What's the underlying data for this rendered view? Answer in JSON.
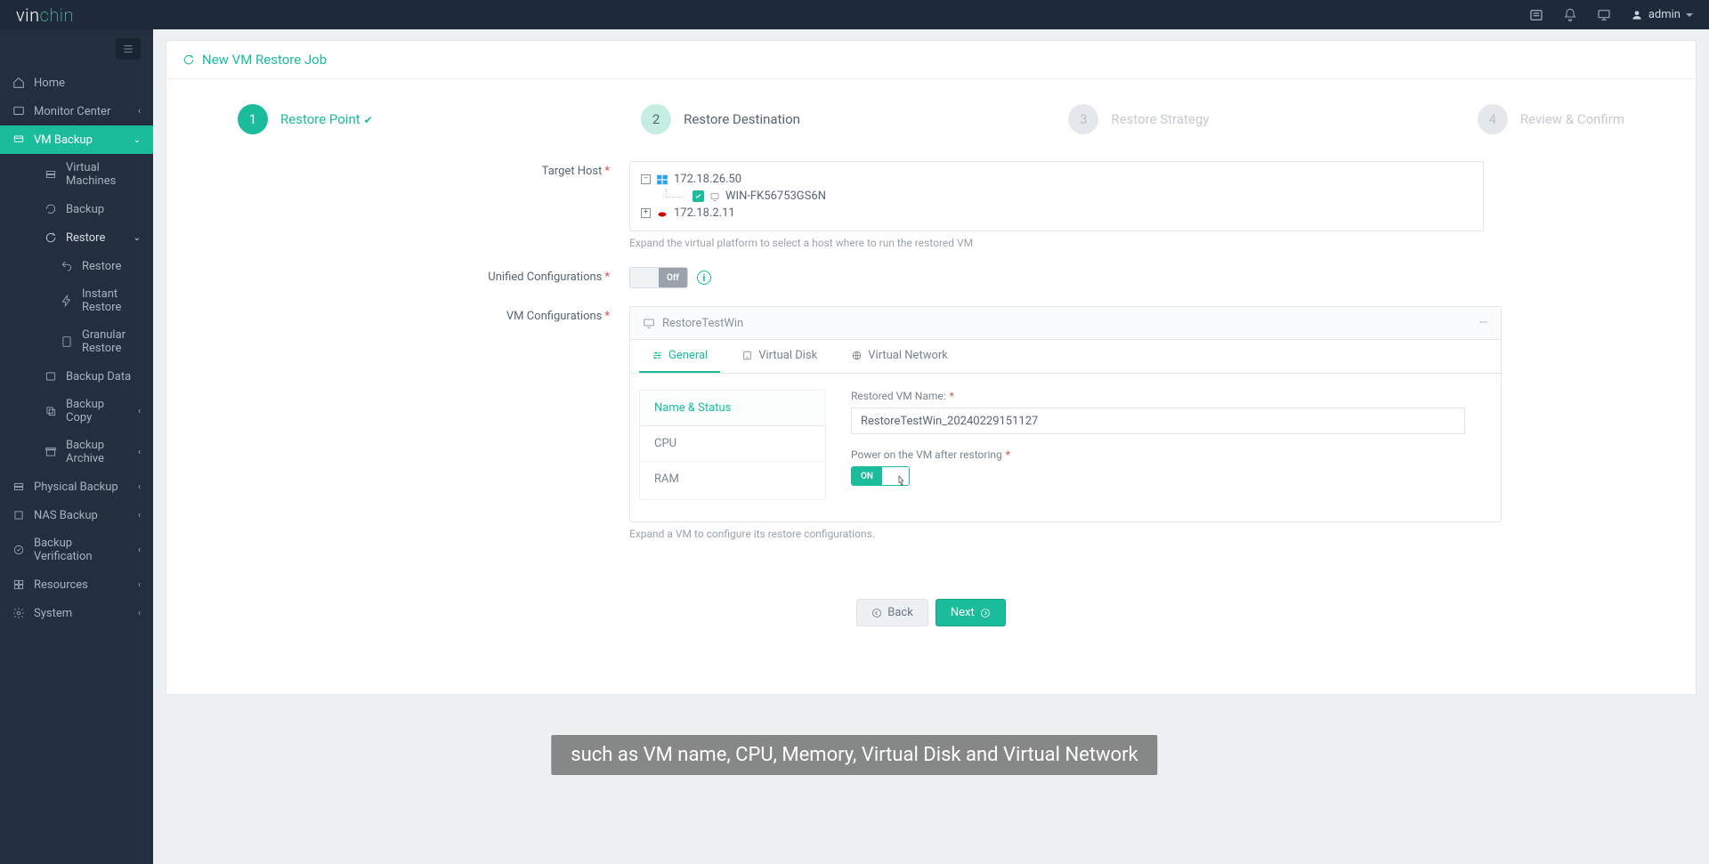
{
  "header": {
    "logo_a": "vin",
    "logo_b": "chin",
    "user": "admin"
  },
  "sidebar": {
    "home": "Home",
    "monitor": "Monitor Center",
    "vm_backup": "VM Backup",
    "virtual_machines": "Virtual Machines",
    "backup": "Backup",
    "restore": "Restore",
    "restore_sub": "Restore",
    "instant_restore": "Instant Restore",
    "granular_restore": "Granular Restore",
    "backup_data": "Backup Data",
    "backup_copy": "Backup Copy",
    "backup_archive": "Backup Archive",
    "physical_backup": "Physical Backup",
    "nas_backup": "NAS Backup",
    "backup_verification": "Backup Verification",
    "resources": "Resources",
    "system": "System"
  },
  "page": {
    "title": "New VM Restore Job"
  },
  "wizard": {
    "s1_num": "1",
    "s1_label": "Restore Point",
    "s2_num": "2",
    "s2_label": "Restore Destination",
    "s3_num": "3",
    "s3_label": "Restore Strategy",
    "s4_num": "4",
    "s4_label": "Review & Confirm"
  },
  "form": {
    "target_host_label": "Target Host",
    "unified_config_label": "Unified Configurations",
    "vm_config_label": "VM Configurations",
    "tree": {
      "host1": "172.18.26.50",
      "vm1": "WIN-FK56753GS6N",
      "host2": "172.18.2.11"
    },
    "tree_helper": "Expand the virtual platform to select a host where to run the restored VM",
    "toggle_off": "Off",
    "vm_name": "RestoreTestWin",
    "vm_config_helper": "Expand a VM to configure its restore configurations."
  },
  "tabs": {
    "general": "General",
    "vdisk": "Virtual Disk",
    "vnet": "Virtual Network"
  },
  "sidelist": {
    "name_status": "Name & Status",
    "cpu": "CPU",
    "ram": "RAM"
  },
  "detail": {
    "name_label": "Restored VM Name:",
    "name_value": "RestoreTestWin_20240229151127",
    "power_label": "Power on the VM after restoring",
    "toggle_on": "ON"
  },
  "buttons": {
    "back": "Back",
    "next": "Next"
  },
  "caption": "such as VM name, CPU, Memory, Virtual Disk and Virtual Network"
}
